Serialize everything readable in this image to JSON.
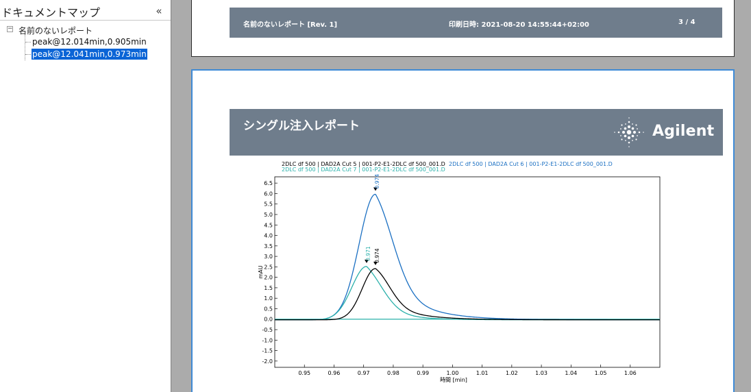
{
  "docmap": {
    "title": "ドキュメントマップ",
    "collapse_glyph": "«",
    "root_toggle": "−",
    "root_label": "名前のないレポート",
    "items": [
      {
        "label": "peak@12.014min,0.905min",
        "selected": false
      },
      {
        "label": "peak@12.041min,0.973min",
        "selected": true
      }
    ]
  },
  "page3_footer": {
    "title": "名前のないレポート [Rev. 1]",
    "print_date": "印刷日時: 2021-08-20 14:55:44+02:00",
    "page": "3 / 4"
  },
  "report_header": {
    "title": "シングル注入レポート",
    "logo_text": "Agilent"
  },
  "colors": {
    "header_bar": "#6f7d8c",
    "selection": "#0a64d6",
    "page_border": "#3e8ad6"
  },
  "chart_data": {
    "type": "line",
    "legend": [
      {
        "parts": [
          "2DLC df 500",
          "DAD2A Cut 5",
          "001-P2-E1-2DLC df 500_001.D"
        ],
        "color": "#000000"
      },
      {
        "parts": [
          "2DLC df 500",
          "DAD2A Cut 6",
          "001-P2-E1-2DLC df 500_001.D"
        ],
        "color": "#1a6fc2"
      },
      {
        "parts": [
          "2DLC df 500",
          "DAD2A Cut 7",
          "001-P2-E1-2DLC df 500_001.D"
        ],
        "color": "#2ab0aa"
      }
    ],
    "xlabel": "時間 [min]",
    "ylabel": "mAU",
    "xlim": [
      0.94,
      1.07
    ],
    "ylim": [
      -2.3,
      6.8
    ],
    "xticks": [
      0.95,
      0.96,
      0.97,
      0.98,
      0.99,
      1.0,
      1.01,
      1.02,
      1.03,
      1.04,
      1.05,
      1.06
    ],
    "yticks": [
      -2.0,
      -1.5,
      -1.0,
      -0.5,
      0.0,
      0.5,
      1.0,
      1.5,
      2.0,
      2.5,
      3.0,
      3.5,
      4.0,
      4.5,
      5.0,
      5.5,
      6.0,
      6.5
    ],
    "series": [
      {
        "name": "DAD2A Cut 6",
        "color": "#1a6fc2",
        "peak_x": 0.974,
        "peak_y": 6.0,
        "sigma_left": 0.0055,
        "tau": 0.011,
        "peak_label": "0.974"
      },
      {
        "name": "DAD2A Cut 7",
        "color": "#2ab0aa",
        "peak_x": 0.971,
        "peak_y": 2.55,
        "sigma_left": 0.005,
        "tau": 0.008,
        "peak_label": "0.971"
      },
      {
        "name": "DAD2A Cut 5",
        "color": "#000000",
        "peak_x": 0.974,
        "peak_y": 2.45,
        "sigma_left": 0.0045,
        "tau": 0.01,
        "peak_label": "0.974"
      }
    ]
  }
}
